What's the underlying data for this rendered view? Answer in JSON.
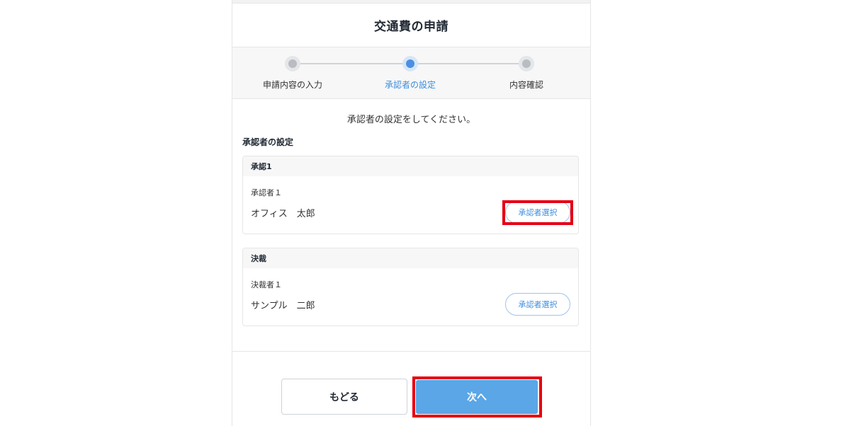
{
  "header": {
    "title": "交通費の申請"
  },
  "stepper": {
    "steps": [
      {
        "label": "申請内容の入力",
        "state": "done"
      },
      {
        "label": "承認者の設定",
        "state": "active"
      },
      {
        "label": "内容確認",
        "state": "pending"
      }
    ]
  },
  "main": {
    "instruction": "承認者の設定をしてください。",
    "section_title": "承認者の設定",
    "cards": [
      {
        "heading": "承認1",
        "role_label": "承認者１",
        "person": "オフィス　太郎",
        "button_label": "承認者選択",
        "highlighted": true
      },
      {
        "heading": "決裁",
        "role_label": "決裁者１",
        "person": "サンプル　二郎",
        "button_label": "承認者選択",
        "highlighted": false
      }
    ]
  },
  "footer": {
    "back_label": "もどる",
    "next_label": "次へ"
  },
  "colors": {
    "accent": "#4a90e2",
    "primary_button": "#5aa6e6",
    "highlight": "#e50012"
  }
}
